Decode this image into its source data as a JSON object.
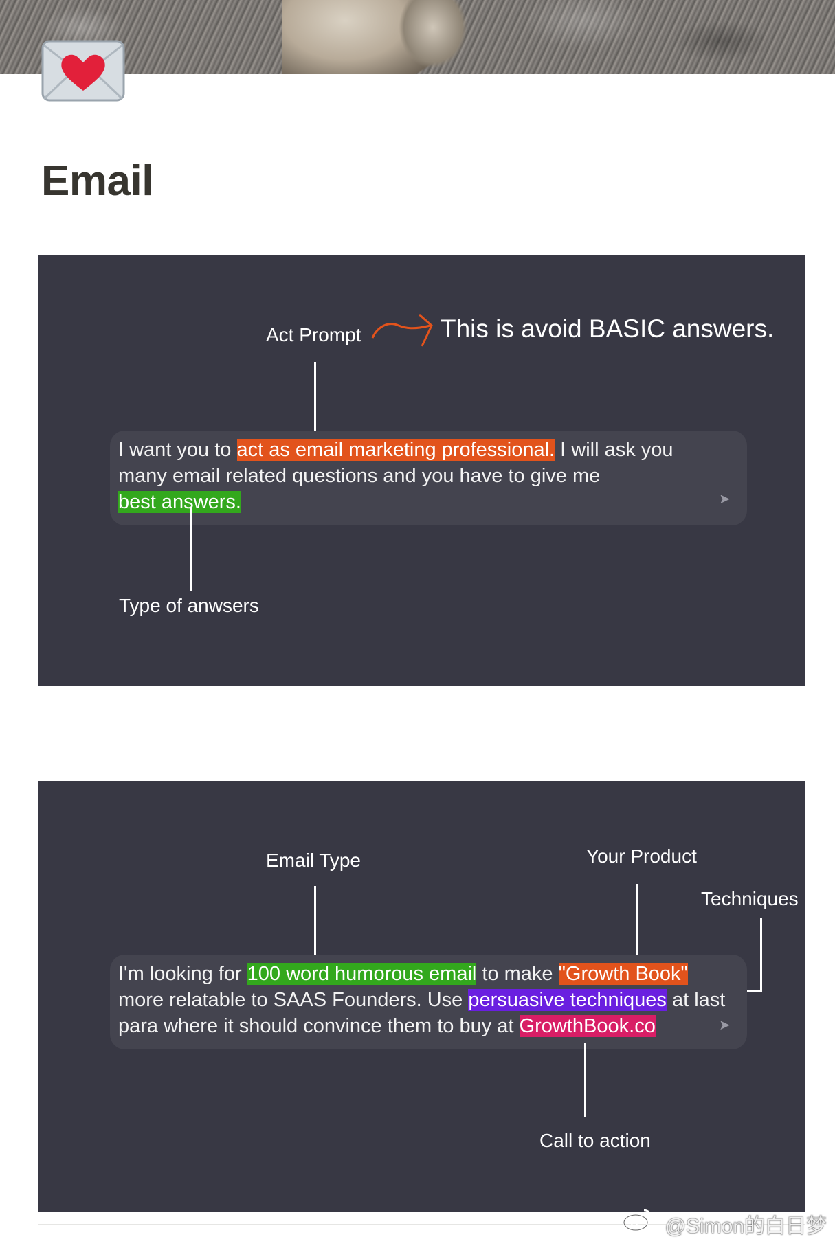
{
  "page": {
    "title": "Email",
    "icon": "love-letter-icon"
  },
  "card1": {
    "act_label": "Act Prompt",
    "basic_note": "This is avoid BASIC answers.",
    "type_label": "Type of anwsers",
    "prompt": {
      "p1": "I want you to ",
      "hl1": "act as email marketing professional.",
      "p2": " I will ask you",
      "p3": "many email related questions and you have to give me",
      "hl2": "best answers."
    }
  },
  "card2": {
    "email_type_label": "Email Type",
    "product_label": "Your Product",
    "techniques_label": "Techniques",
    "cta_label": "Call to action",
    "prompt": {
      "p1": "I'm looking for ",
      "hl1": "100 word humorous email",
      "p2": " to make ",
      "hl2": "\"Growth Book\"",
      "p3": "more relatable to SAAS Founders. Use ",
      "hl3": "persuasive techniques",
      "p4": " at last",
      "p5": "para where it should convince them to buy at ",
      "hl4": "GrowthBook.co"
    }
  },
  "watermark": {
    "text": "@Simon的白日梦",
    "icon": "weibo-icon"
  },
  "colors": {
    "card_bg": "#383844",
    "orange": "#e2531c",
    "green": "#33a81d",
    "purple": "#6a1fe0",
    "pink": "#d81e66"
  }
}
